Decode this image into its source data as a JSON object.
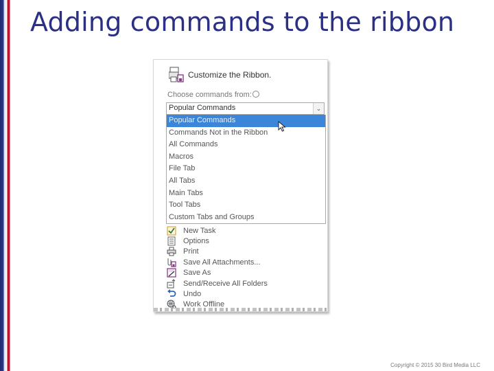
{
  "slide": {
    "title": "Adding commands to the ribbon",
    "copyright": "Copyright © 2015 30 Bird Media LLC"
  },
  "dialog": {
    "header_label": "Customize the Ribbon.",
    "choose_label": "Choose commands from:",
    "combo_value": "Popular Commands",
    "dropdown_options": [
      "Popular Commands",
      "Commands Not in the Ribbon",
      "All Commands",
      "Macros",
      "File Tab",
      "All Tabs",
      "Main Tabs",
      "Tool Tabs",
      "Custom Tabs and Groups"
    ],
    "selected_option": "Popular Commands",
    "commands": [
      {
        "label": "New Task",
        "icon": "task-check-icon"
      },
      {
        "label": "Options",
        "icon": "options-icon"
      },
      {
        "label": "Print",
        "icon": "printer-icon"
      },
      {
        "label": "Save All Attachments...",
        "icon": "attachments-icon"
      },
      {
        "label": "Save As",
        "icon": "save-as-icon"
      },
      {
        "label": "Send/Receive All Folders",
        "icon": "send-receive-icon"
      },
      {
        "label": "Undo",
        "icon": "undo-icon"
      },
      {
        "label": "Work Offline",
        "icon": "globe-icon"
      }
    ]
  },
  "colors": {
    "title": "#2b3085",
    "selection": "#3b86d8",
    "accent_red": "#c8102e",
    "accent_navy": "#1f2a6b"
  }
}
